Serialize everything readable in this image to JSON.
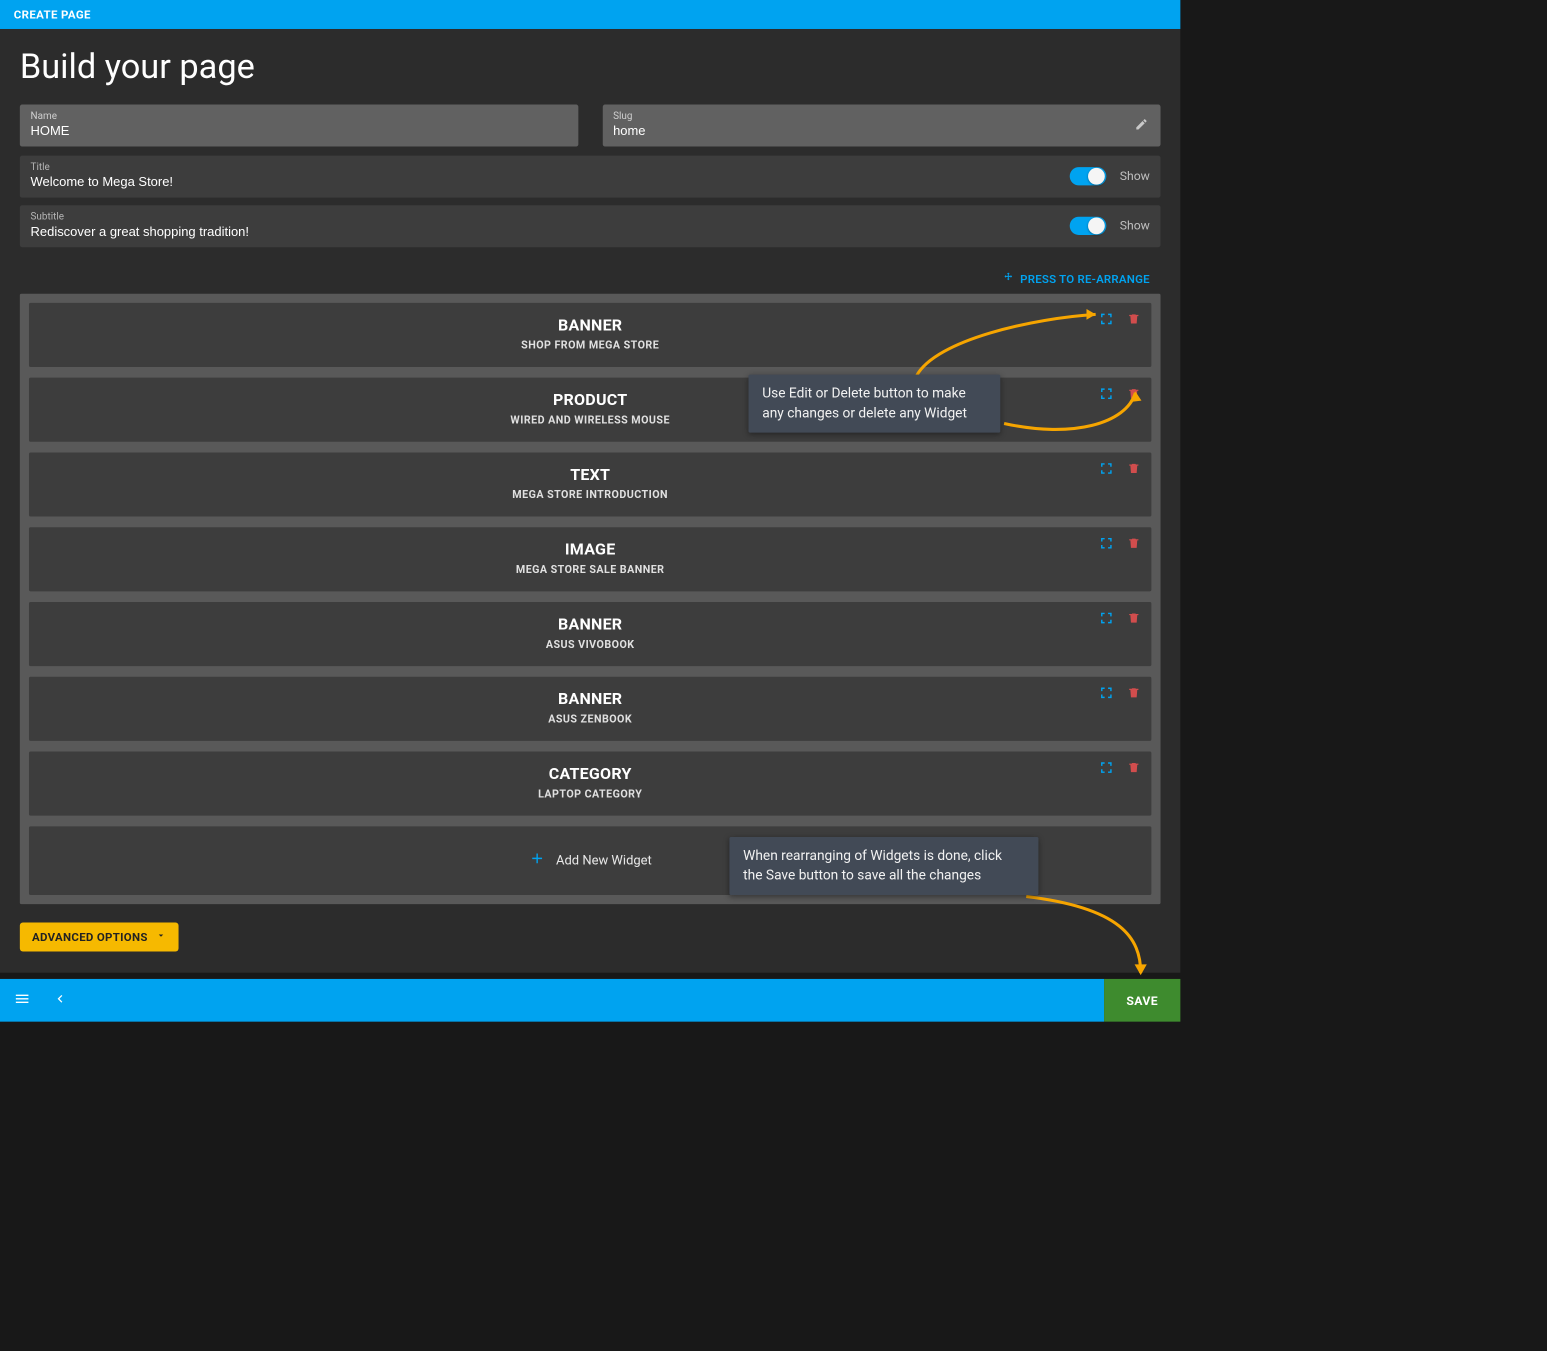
{
  "topbar": {
    "title": "CREATE PAGE"
  },
  "page_title": "Build your page",
  "fields": {
    "name_label": "Name",
    "name_value": "HOME",
    "slug_label": "Slug",
    "slug_value": "home",
    "title_label": "Title",
    "title_value": "Welcome to Mega Store!",
    "subtitle_label": "Subtitle",
    "subtitle_value": "Rediscover a great shopping tradition!",
    "show_label": "Show"
  },
  "rearrange_label": "PRESS TO RE-ARRANGE",
  "widgets": [
    {
      "type": "BANNER",
      "subtitle": "SHOP FROM MEGA STORE"
    },
    {
      "type": "PRODUCT",
      "subtitle": "WIRED AND WIRELESS MOUSE"
    },
    {
      "type": "TEXT",
      "subtitle": "MEGA STORE INTRODUCTION"
    },
    {
      "type": "IMAGE",
      "subtitle": "MEGA STORE SALE BANNER"
    },
    {
      "type": "BANNER",
      "subtitle": "ASUS VIVOBOOK"
    },
    {
      "type": "BANNER",
      "subtitle": "ASUS ZENBOOK"
    },
    {
      "type": "CATEGORY",
      "subtitle": "LAPTOP CATEGORY"
    }
  ],
  "add_widget_label": "Add New Widget",
  "adv_options_label": "ADVANCED OPTIONS",
  "save_label": "SAVE",
  "callouts": {
    "edit_delete": "Use Edit or Delete button to make any changes or delete any Widget",
    "save_hint": "When rearranging of Widgets is done, click the Save button to save all the changes"
  }
}
